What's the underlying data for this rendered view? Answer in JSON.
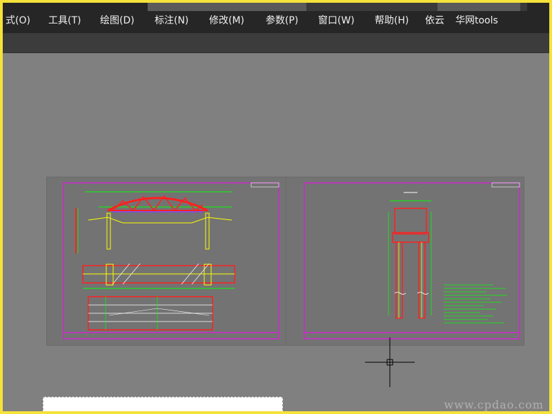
{
  "menubar": {
    "items": [
      {
        "label": "式(O)"
      },
      {
        "label": "工具(T)"
      },
      {
        "label": "绘图(D)"
      },
      {
        "label": "标注(N)"
      },
      {
        "label": "修改(M)"
      },
      {
        "label": "参数(P)"
      },
      {
        "label": "窗口(W)"
      },
      {
        "label": "帮助(H)"
      },
      {
        "label": "依云"
      },
      {
        "label": "华网tools"
      }
    ]
  },
  "watermark": {
    "text": "www.cpdao.com"
  },
  "colors": {
    "frame_border": "#f5e23a",
    "menubar_bg": "#262626",
    "canvas_bg": "#808080",
    "line_green": "#00ff00",
    "line_red": "#ff2020",
    "line_yellow": "#ffff00",
    "line_magenta": "#ff00ff"
  }
}
